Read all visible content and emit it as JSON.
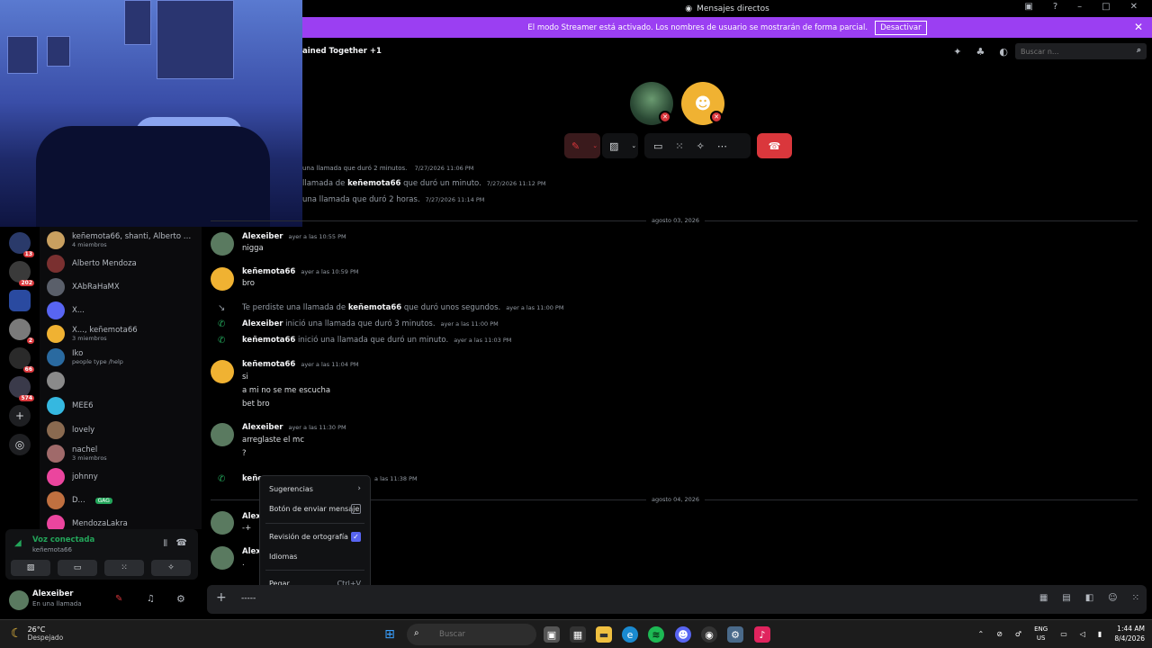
{
  "window": {
    "title": "Mensajes directos"
  },
  "banner": {
    "text": "El modo Streamer está activado. Los nombres de usuario se mostrarán de forma parcial.",
    "button": "Desactivar"
  },
  "header": {
    "channel": "ained Together +1",
    "search_placeholder": "Buscar n..."
  },
  "servers": [
    {
      "count": "13"
    },
    {
      "count": "202"
    },
    {
      "count": ""
    },
    {
      "count": "2"
    },
    {
      "count": "66"
    },
    {
      "count": "574"
    }
  ],
  "dms": [
    {
      "name": "keñemota66, shanti, Alberto M...",
      "sub": "4 miembros",
      "color": "#c9a060"
    },
    {
      "name": "Alberto Mendoza",
      "sub": "",
      "color": "#7a3030"
    },
    {
      "name": "XAbRaHaMX",
      "sub": "",
      "color": "#5a5f6a"
    },
    {
      "name": "X...",
      "sub": "",
      "color": "#5865f2"
    },
    {
      "name": "X..., keñemota66",
      "sub": "3 miembros",
      "color": "#f0b232"
    },
    {
      "name": "Iko",
      "sub": "people type /help",
      "color": "#2a6aa0"
    },
    {
      "name": "",
      "sub": "",
      "color": "#8a8a8a"
    },
    {
      "name": "MEE6",
      "sub": "",
      "color": "#35b8e0"
    },
    {
      "name": "lovely",
      "sub": "",
      "color": "#8a6a50"
    },
    {
      "name": "nachel",
      "sub": "3 miembros",
      "color": "#a06a6a"
    },
    {
      "name": "johnny",
      "sub": "",
      "color": "#eb459e"
    },
    {
      "name": "D...",
      "sub": "",
      "color": "#c07040",
      "badge": "GAG"
    },
    {
      "name": "MendozaLakra",
      "sub": "",
      "color": "#eb459e"
    }
  ],
  "voice": {
    "title": "Voz conectada",
    "sub": "keñemota66"
  },
  "user": {
    "name": "Alexeiber",
    "status": "En una llamada"
  },
  "history": [
    {
      "text": "una llamada que duró 2 minutos.",
      "ts": "7/27/2026 11:06 PM"
    },
    {
      "pre": "llamada de ",
      "bold": "keñemota66",
      "post": " que duró un minuto.",
      "ts": "7/27/2026 11:12 PM"
    },
    {
      "text": "una llamada que duró 2 horas.",
      "ts": "7/27/2026 11:14 PM"
    }
  ],
  "dates": {
    "d1": "agosto 03, 2026",
    "d2": "agosto 04, 2026"
  },
  "messages": {
    "m1": {
      "author": "Alexeiber",
      "ts": "ayer a las 10:55 PM",
      "lines": [
        "nigga"
      ]
    },
    "m2": {
      "author": "keñemota66",
      "ts": "ayer a las 10:59 PM",
      "lines": [
        "bro"
      ]
    },
    "s1": {
      "pre": "Te perdiste una llamada de ",
      "bold": "keñemota66",
      "post": " que duró unos segundos.",
      "ts": "ayer a las 11:00 PM"
    },
    "s2": {
      "bold": "Alexeiber",
      "post": " inició una llamada que duró 3 minutos.",
      "ts": "ayer a las 11:00 PM"
    },
    "s3": {
      "bold": "keñemota66",
      "post": " inició una llamada que duró un minuto.",
      "ts": "ayer a las 11:03 PM"
    },
    "m3": {
      "author": "keñemota66",
      "ts": "ayer a las 11:04 PM",
      "lines": [
        "si",
        "a mi no se me escucha",
        "bet bro"
      ]
    },
    "m4": {
      "author": "Alexeiber",
      "ts": "ayer a las 11:30 PM",
      "lines": [
        "arreglaste el mc",
        "?"
      ]
    },
    "s4": {
      "bold": "keñe",
      "ts": "a las 11:38 PM"
    },
    "m5": {
      "author": "Alex",
      "lines": [
        "-+"
      ]
    },
    "m6": {
      "author": "Alex",
      "lines": [
        "."
      ]
    }
  },
  "context_menu": {
    "suggestions": "Sugerencias",
    "send_button": "Botón de enviar mensaje",
    "spellcheck": "Revisión de ortografía",
    "languages": "Idiomas",
    "paste": "Pegar",
    "paste_shortcut": "Ctrl+V"
  },
  "composer": {
    "text": "-----"
  },
  "taskbar": {
    "temp": "26°C",
    "condition": "Despejado",
    "search": "Buscar",
    "lang": "ENG",
    "region": "US",
    "time": "1:44 AM",
    "date": "8/4/2026"
  },
  "colors": {
    "accent": "#5865f2",
    "banner": "#9b3ff2",
    "danger": "#da373c",
    "online": "#23a55a"
  }
}
